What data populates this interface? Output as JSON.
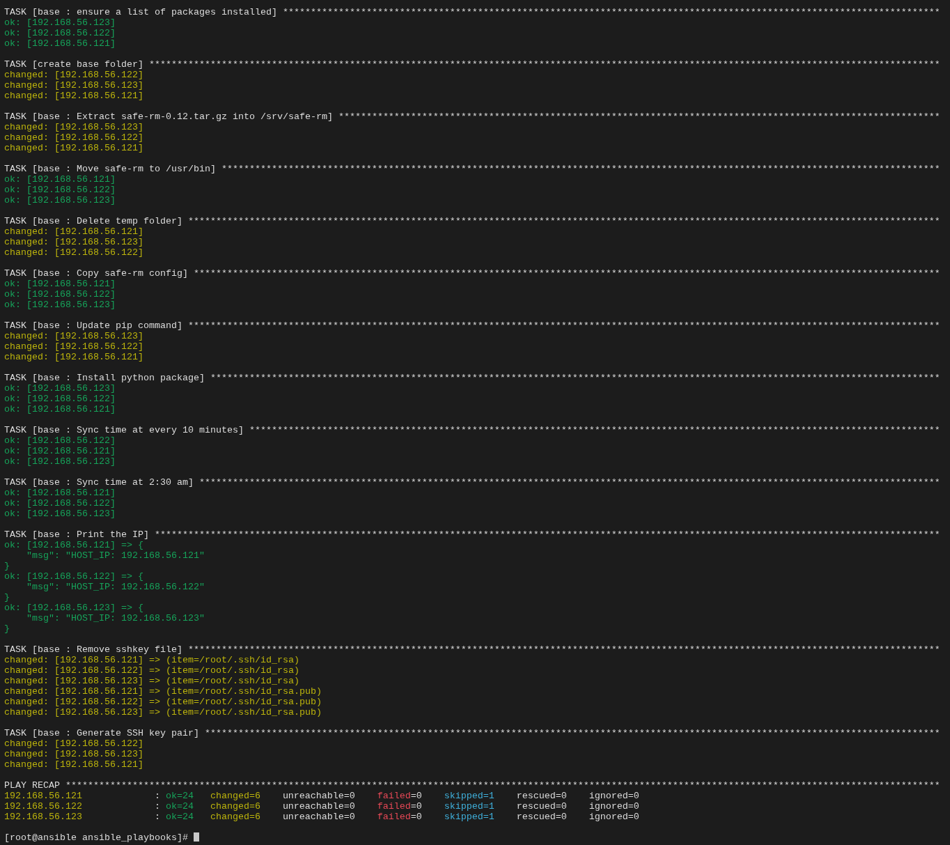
{
  "tasks": [
    {
      "title": "TASK [base : ensure a list of packages installed]",
      "rule": "**********************************************************************************************************************",
      "lines": [
        {
          "color": "#16a35a",
          "text": "ok: [192.168.56.123]"
        },
        {
          "color": "#16a35a",
          "text": "ok: [192.168.56.122]"
        },
        {
          "color": "#16a35a",
          "text": "ok: [192.168.56.121]"
        }
      ]
    },
    {
      "title": "TASK [create base folder]",
      "rule": "**********************************************************************************************************************************************",
      "lines": [
        {
          "color": "#bcb40c",
          "text": "changed: [192.168.56.122]"
        },
        {
          "color": "#bcb40c",
          "text": "changed: [192.168.56.123]"
        },
        {
          "color": "#bcb40c",
          "text": "changed: [192.168.56.121]"
        }
      ]
    },
    {
      "title": "TASK [base : Extract safe-rm-0.12.tar.gz into /srv/safe-rm]",
      "rule": "************************************************************************************************************",
      "lines": [
        {
          "color": "#bcb40c",
          "text": "changed: [192.168.56.123]"
        },
        {
          "color": "#bcb40c",
          "text": "changed: [192.168.56.122]"
        },
        {
          "color": "#bcb40c",
          "text": "changed: [192.168.56.121]"
        }
      ]
    },
    {
      "title": "TASK [base : Move safe-rm to /usr/bin]",
      "rule": "*********************************************************************************************************************************",
      "lines": [
        {
          "color": "#16a35a",
          "text": "ok: [192.168.56.121]"
        },
        {
          "color": "#16a35a",
          "text": "ok: [192.168.56.122]"
        },
        {
          "color": "#16a35a",
          "text": "ok: [192.168.56.123]"
        }
      ]
    },
    {
      "title": "TASK [base : Delete temp folder]",
      "rule": "***************************************************************************************************************************************",
      "lines": [
        {
          "color": "#bcb40c",
          "text": "changed: [192.168.56.121]"
        },
        {
          "color": "#bcb40c",
          "text": "changed: [192.168.56.123]"
        },
        {
          "color": "#bcb40c",
          "text": "changed: [192.168.56.122]"
        }
      ]
    },
    {
      "title": "TASK [base : Copy safe-rm config]",
      "rule": "**************************************************************************************************************************************",
      "lines": [
        {
          "color": "#16a35a",
          "text": "ok: [192.168.56.121]"
        },
        {
          "color": "#16a35a",
          "text": "ok: [192.168.56.122]"
        },
        {
          "color": "#16a35a",
          "text": "ok: [192.168.56.123]"
        }
      ]
    },
    {
      "title": "TASK [base : Update pip command]",
      "rule": "***************************************************************************************************************************************",
      "lines": [
        {
          "color": "#bcb40c",
          "text": "changed: [192.168.56.123]"
        },
        {
          "color": "#bcb40c",
          "text": "changed: [192.168.56.122]"
        },
        {
          "color": "#bcb40c",
          "text": "changed: [192.168.56.121]"
        }
      ]
    },
    {
      "title": "TASK [base : Install python package]",
      "rule": "***********************************************************************************************************************************",
      "lines": [
        {
          "color": "#16a35a",
          "text": "ok: [192.168.56.123]"
        },
        {
          "color": "#16a35a",
          "text": "ok: [192.168.56.122]"
        },
        {
          "color": "#16a35a",
          "text": "ok: [192.168.56.121]"
        }
      ]
    },
    {
      "title": "TASK [base : Sync time at every 10 minutes]",
      "rule": "****************************************************************************************************************************",
      "lines": [
        {
          "color": "#16a35a",
          "text": "ok: [192.168.56.122]"
        },
        {
          "color": "#16a35a",
          "text": "ok: [192.168.56.121]"
        },
        {
          "color": "#16a35a",
          "text": "ok: [192.168.56.123]"
        }
      ]
    },
    {
      "title": "TASK [base : Sync time at 2:30 am]",
      "rule": "*************************************************************************************************************************************",
      "lines": [
        {
          "color": "#16a35a",
          "text": "ok: [192.168.56.121]"
        },
        {
          "color": "#16a35a",
          "text": "ok: [192.168.56.122]"
        },
        {
          "color": "#16a35a",
          "text": "ok: [192.168.56.123]"
        }
      ]
    },
    {
      "title": "TASK [base : Print the IP]",
      "rule": "*********************************************************************************************************************************************",
      "lines": [
        {
          "color": "#16a35a",
          "kind": "line",
          "text": "ok: [192.168.56.121] => {"
        },
        {
          "color": "#16a35a",
          "kind": "field",
          "text": "\"msg\": \"HOST_IP: 192.168.56.121\""
        },
        {
          "color": "#16a35a",
          "kind": "line",
          "text": "}"
        },
        {
          "color": "#16a35a",
          "kind": "line",
          "text": "ok: [192.168.56.122] => {"
        },
        {
          "color": "#16a35a",
          "kind": "field",
          "text": "\"msg\": \"HOST_IP: 192.168.56.122\""
        },
        {
          "color": "#16a35a",
          "kind": "line",
          "text": "}"
        },
        {
          "color": "#16a35a",
          "kind": "line",
          "text": "ok: [192.168.56.123] => {"
        },
        {
          "color": "#16a35a",
          "kind": "field",
          "text": "\"msg\": \"HOST_IP: 192.168.56.123\""
        },
        {
          "color": "#16a35a",
          "kind": "line",
          "text": "}"
        }
      ]
    },
    {
      "title": "TASK [base : Remove sshkey file]",
      "rule": "***************************************************************************************************************************************",
      "lines": [
        {
          "color": "#bcb40c",
          "text": "changed: [192.168.56.121] => (item=/root/.ssh/id_rsa)"
        },
        {
          "color": "#bcb40c",
          "text": "changed: [192.168.56.122] => (item=/root/.ssh/id_rsa)"
        },
        {
          "color": "#bcb40c",
          "text": "changed: [192.168.56.123] => (item=/root/.ssh/id_rsa)"
        },
        {
          "color": "#bcb40c",
          "text": "changed: [192.168.56.121] => (item=/root/.ssh/id_rsa.pub)"
        },
        {
          "color": "#bcb40c",
          "text": "changed: [192.168.56.122] => (item=/root/.ssh/id_rsa.pub)"
        },
        {
          "color": "#bcb40c",
          "text": "changed: [192.168.56.123] => (item=/root/.ssh/id_rsa.pub)"
        }
      ]
    },
    {
      "title": "TASK [base : Generate SSH key pair]",
      "rule": "************************************************************************************************************************************",
      "lines": [
        {
          "color": "#bcb40c",
          "text": "changed: [192.168.56.122]"
        },
        {
          "color": "#bcb40c",
          "text": "changed: [192.168.56.123]"
        },
        {
          "color": "#bcb40c",
          "text": "changed: [192.168.56.121]"
        }
      ]
    }
  ],
  "recap": {
    "title": "PLAY RECAP",
    "rule": "*************************************************************************************************************************************************************",
    "hosts": [
      {
        "host": "192.168.56.121",
        "color": "#bcb40c",
        "separator": ":",
        "ok": "ok=24",
        "changed": "changed=6",
        "unreachable": "unreachable=0",
        "failed_label": "failed",
        "failed_value": "=0",
        "skipped": "skipped=1",
        "rescued": "rescued=0",
        "ignored": "ignored=0"
      },
      {
        "host": "192.168.56.122",
        "color": "#bcb40c",
        "separator": ":",
        "ok": "ok=24",
        "changed": "changed=6",
        "unreachable": "unreachable=0",
        "failed_label": "failed",
        "failed_value": "=0",
        "skipped": "skipped=1",
        "rescued": "rescued=0",
        "ignored": "ignored=0"
      },
      {
        "host": "192.168.56.123",
        "color": "#bcb40c",
        "separator": ":",
        "ok": "ok=24",
        "changed": "changed=6",
        "unreachable": "unreachable=0",
        "failed_label": "failed",
        "failed_value": "=0",
        "skipped": "skipped=1",
        "rescued": "rescued=0",
        "ignored": "ignored=0"
      }
    ]
  },
  "prompt": "[root@ansible ansible_playbooks]#"
}
